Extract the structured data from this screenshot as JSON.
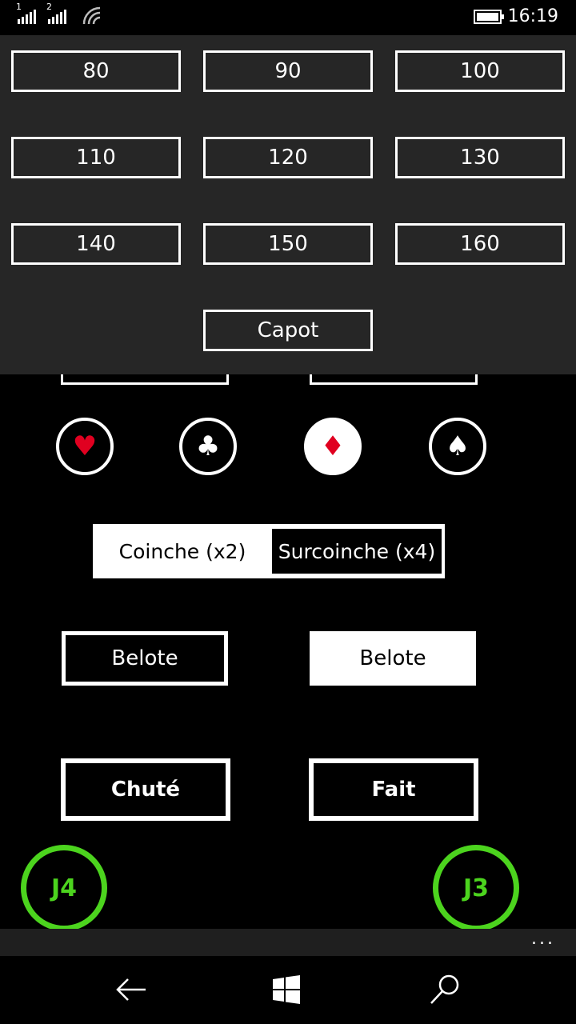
{
  "status_bar": {
    "sim1": "1",
    "sim2": "2",
    "time": "16:19"
  },
  "bids": [
    "80",
    "90",
    "100",
    "110",
    "120",
    "130",
    "140",
    "150",
    "160"
  ],
  "capot_label": "Capot",
  "suits": [
    {
      "name": "heart",
      "glyph": "♥",
      "color": "#e00020",
      "selected": false
    },
    {
      "name": "club",
      "glyph": "♣",
      "color": "#ffffff",
      "selected": false
    },
    {
      "name": "diamond",
      "glyph": "♦",
      "color": "#e00020",
      "selected": true
    },
    {
      "name": "spade",
      "glyph": "♠",
      "color": "#ffffff",
      "selected": false
    }
  ],
  "coinche": {
    "coinche_label": "Coinche (x2)",
    "surcoinche_label": "Surcoinche (x4)",
    "selected": "surcoinche"
  },
  "belote": {
    "left_label": "Belote",
    "right_label": "Belote",
    "right_active": true
  },
  "results": {
    "chute_label": "Chuté",
    "fait_label": "Fait"
  },
  "players": {
    "left": "J4",
    "right": "J3",
    "accent": "#4cd41e"
  },
  "app_bar": {
    "more_label": "..."
  }
}
